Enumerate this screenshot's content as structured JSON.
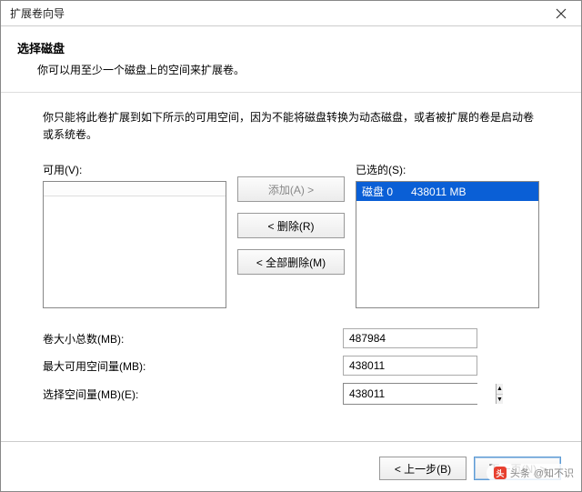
{
  "window": {
    "title": "扩展卷向导"
  },
  "header": {
    "title": "选择磁盘",
    "subtitle": "你可以用至少一个磁盘上的空间来扩展卷。"
  },
  "description": "你只能将此卷扩展到如下所示的可用空间，因为不能将磁盘转换为动态磁盘，或者被扩展的卷是启动卷或系统卷。",
  "available": {
    "label": "可用(V):"
  },
  "selected": {
    "label": "已选的(S):",
    "items": [
      "磁盘 0      438011 MB"
    ]
  },
  "buttons": {
    "add": "添加(A) >",
    "remove": "< 删除(R)",
    "remove_all": "< 全部删除(M)",
    "back": "< 上一步(B)",
    "next": "下一页(N) >"
  },
  "fields": {
    "total_label": "卷大小总数(MB):",
    "total_value": "487984",
    "max_label": "最大可用空间量(MB):",
    "max_value": "438011",
    "select_label": "选择空间量(MB)(E):",
    "select_value": "438011"
  },
  "watermark": {
    "source": "头条",
    "author": "@知不识"
  }
}
